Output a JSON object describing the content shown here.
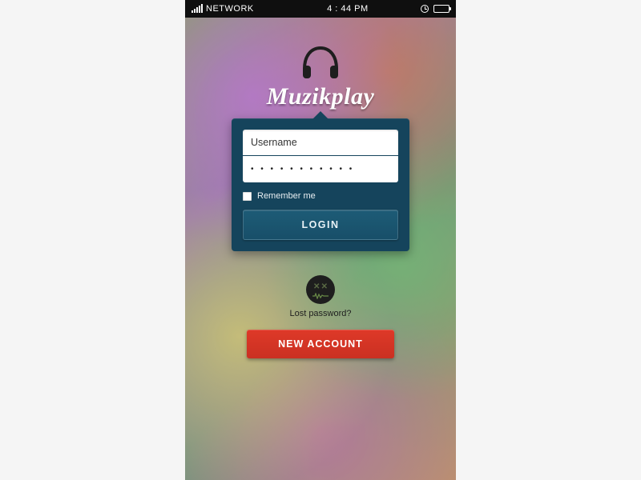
{
  "statusbar": {
    "carrier": "NETWORK",
    "time": "4 : 44 PM"
  },
  "app": {
    "name": "Muzikplay"
  },
  "login": {
    "username_placeholder": "Username",
    "password_value": "• • • • • • • • • • •",
    "remember_label": "Remember me",
    "login_label": "LOGIN"
  },
  "lost": {
    "label": "Lost password?"
  },
  "new_account": {
    "label": "NEW ACCOUNT"
  },
  "colors": {
    "card_bg": "#17445a",
    "accent_red": "#d83b2a"
  }
}
